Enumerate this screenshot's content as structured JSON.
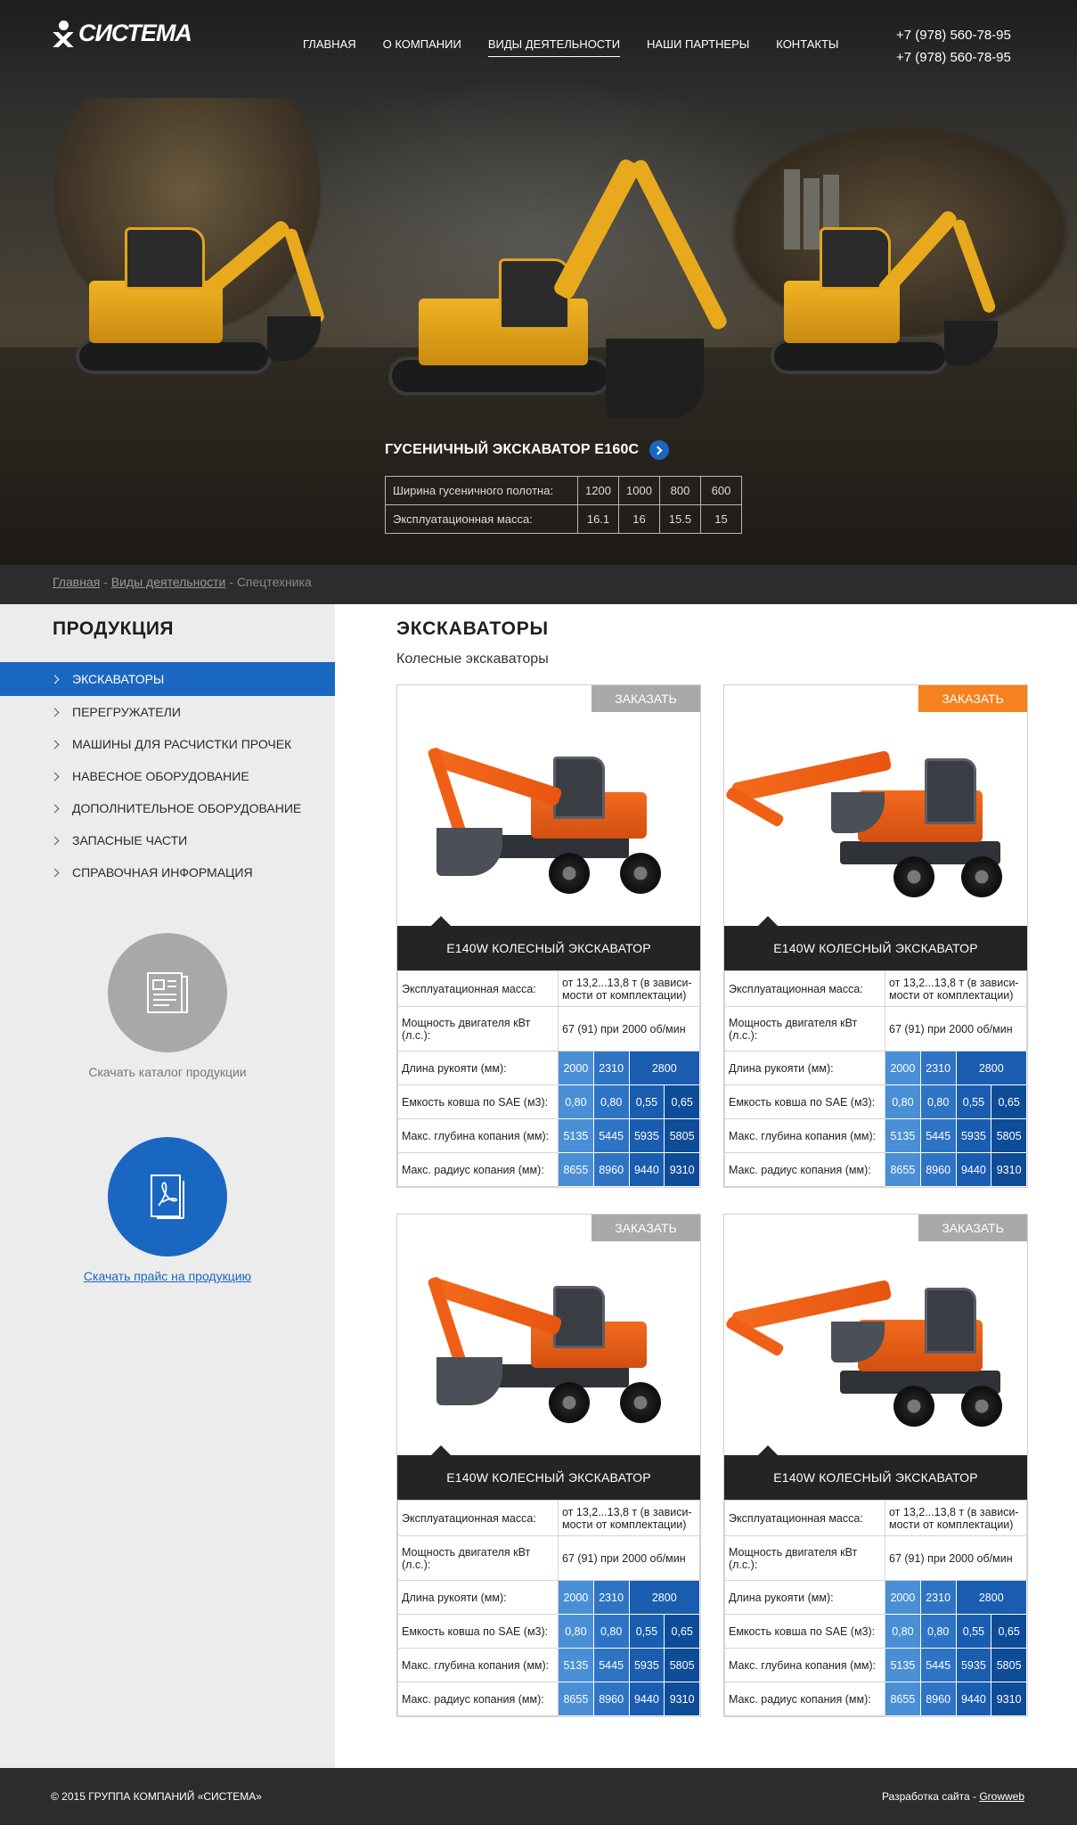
{
  "brand": {
    "logo_text": "СИСТЕМА"
  },
  "nav": {
    "items": [
      "ГЛАВНАЯ",
      "О КОМПАНИИ",
      "ВИДЫ ДЕЯТЕЛЬНОСТИ",
      "НАШИ ПАРТНЕРЫ",
      "КОНТАКТЫ"
    ],
    "active": "ВИДЫ ДЕЯТЕЛЬНОСТИ"
  },
  "phones": [
    "+7 (978) 560-78-95",
    "+7 (978) 560-78-95"
  ],
  "hero": {
    "title": "ГУСЕНИЧНЫЙ ЭКСКАВАТОР E160C",
    "table": [
      {
        "label": "Ширина гусеничного полотна:",
        "values": [
          "1200",
          "1000",
          "800",
          "600"
        ]
      },
      {
        "label": "Эксплуатационная масса:",
        "values": [
          "16.1",
          "16",
          "15.5",
          "15"
        ]
      }
    ]
  },
  "breadcrumbs": {
    "items": [
      "Главная",
      "Виды деятельности"
    ],
    "sep": " - ",
    "current": "Спецтехника"
  },
  "sidebar": {
    "title": "ПРОДУКЦИЯ",
    "menu": [
      "ЭКСКАВАТОРЫ",
      "ПЕРЕГРУЖАТЕЛИ",
      "МАШИНЫ ДЛЯ РАСЧИСТКИ ПРОЧЕК",
      "НАВЕСНОЕ ОБОРУДОВАНИЕ",
      "ДОПОЛНИТЕЛЬНОЕ ОБОРУДОВАНИЕ",
      "ЗАПАСНЫЕ ЧАСТИ",
      "СПРАВОЧНАЯ ИНФОРМАЦИЯ"
    ],
    "active_index": 0,
    "catalog_label": "Скачать каталог продукции",
    "price_label": "Скачать прайс на продукцию"
  },
  "main": {
    "title": "ЭКСКАВАТОРЫ",
    "subtitle": "Колесные экскаваторы",
    "order_label": "ЗАКАЗАТЬ",
    "products": [
      {
        "name": "E140W КОЛЕСНЫЙ ЭКСКАВАТОР",
        "order_highlight": false
      },
      {
        "name": "E140W КОЛЕСНЫЙ ЭКСКАВАТОР",
        "order_highlight": true
      },
      {
        "name": "E140W КОЛЕСНЫЙ ЭКСКАВАТОР",
        "order_highlight": false
      },
      {
        "name": "E140W КОЛЕСНЫЙ ЭКСКАВАТОР",
        "order_highlight": false
      }
    ],
    "specs": {
      "mass_label": "Эксплуатационная масса:",
      "mass_value": "от 13,2...13,8 т (в зависи-мости от комплектации)",
      "power_label": "Мощность двигателя кВт (л.с.):",
      "power_value": "67 (91) при 2000 об/мин",
      "rows": [
        {
          "label": "Длина рукояти (мм):",
          "values": [
            "2000",
            "2310",
            "2800"
          ]
        },
        {
          "label": "Емкость ковша по SAE (м3):",
          "values": [
            "0,80",
            "0,80",
            "0,55",
            "0,65"
          ]
        },
        {
          "label": "Макс. глубина копания (мм):",
          "values": [
            "5135",
            "5445",
            "5935",
            "5805"
          ]
        },
        {
          "label": "Макс. радиус копания (мм):",
          "values": [
            "8655",
            "8960",
            "9440",
            "9310"
          ]
        }
      ]
    }
  },
  "footer": {
    "copyright": "© 2015 ГРУППА КОМПАНИЙ «СИСТЕМА»",
    "dev_prefix": "Разработка сайта - ",
    "dev_link": "Growweb"
  },
  "colors": {
    "accent": "#1a67c2",
    "order_highlight": "#f5821f",
    "dark": "#242424"
  }
}
